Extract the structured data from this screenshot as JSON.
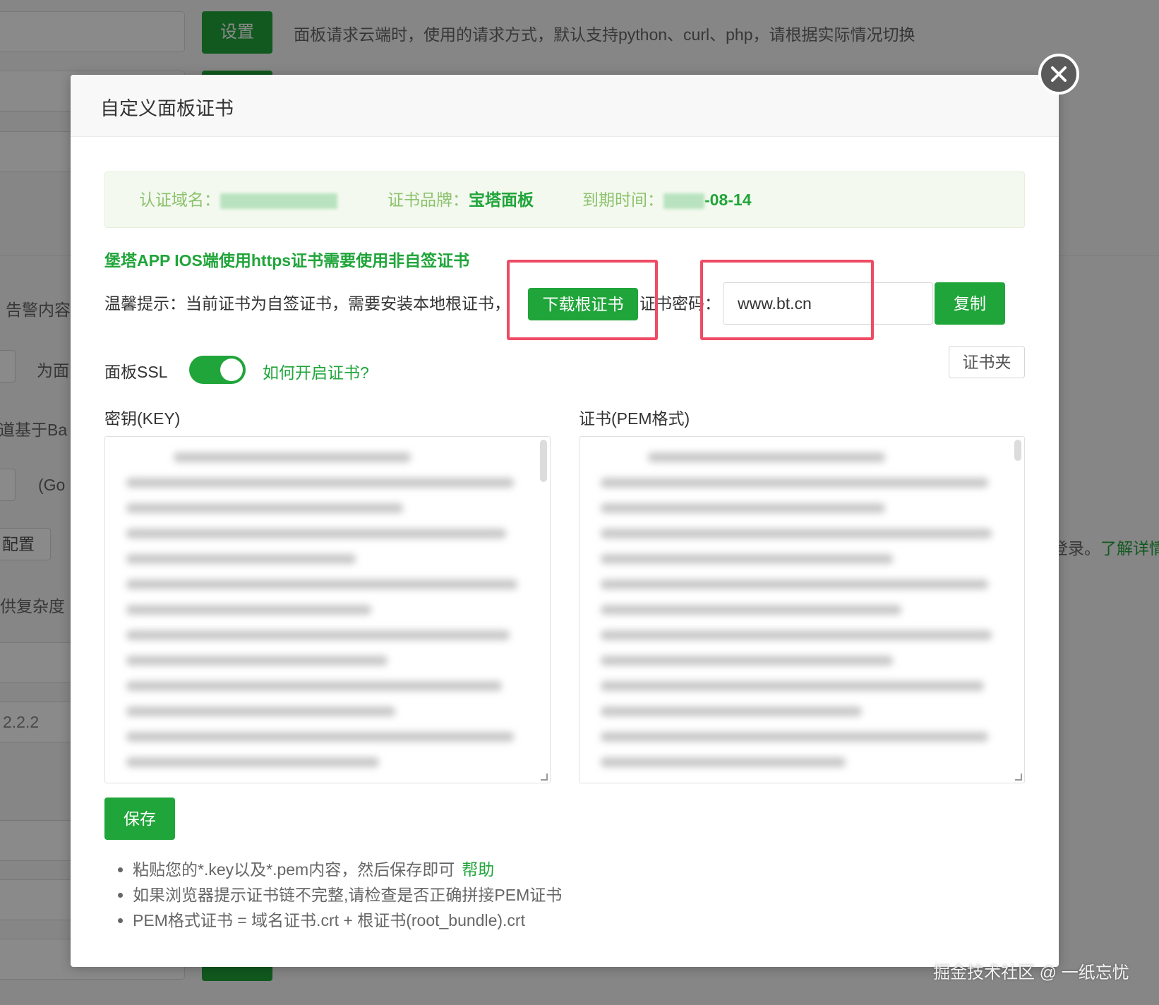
{
  "background": {
    "set_button": "设置",
    "request_method_desc": "面板请求云端时，使用的请求方式，默认支持python、curl、php，请根据实际情况切换",
    "left_snippets": [
      "告警内容",
      "为面",
      "道基于Ba",
      "(Go",
      "配置",
      "供复杂度",
      "2.2.2"
    ],
    "right_snippet": "登录。",
    "right_link": "了解详情"
  },
  "modal": {
    "title": "自定义面板证书",
    "info": {
      "domain_label": "认证域名：",
      "brand_label": "证书品牌：",
      "brand_value": "宝塔面板",
      "expiry_label": "到期时间：",
      "expiry_value": "-08-14"
    },
    "ios_notice": "堡塔APP IOS端使用https证书需要使用非自签证书",
    "tip_label": "温馨提示：当前证书为自签证书，需要安装本地根证书，",
    "download_button": "下载根证书",
    "password_label": "证书密码：",
    "password_value": "www.bt.cn",
    "copy_button": "复制",
    "ssl_label": "面板SSL",
    "ssl_enabled": true,
    "ssl_help_link": "如何开启证书?",
    "cert_folder_button": "证书夹",
    "key_label": "密钥(KEY)",
    "pem_label": "证书(PEM格式)",
    "save_button": "保存",
    "notes": [
      "粘贴您的*.key以及*.pem内容，然后保存即可",
      "如果浏览器提示证书链不完整,请检查是否正确拼接PEM证书",
      "PEM格式证书 = 域名证书.crt + 根证书(root_bundle).crt"
    ],
    "help_link": "帮助"
  },
  "watermark": "掘金技术社区 @ 一纸忘忧",
  "colors": {
    "accent": "#20a53a",
    "highlight": "#ee4b64",
    "info_bg": "#f3f9ee"
  },
  "icons": {
    "close": "close-circle-icon"
  }
}
